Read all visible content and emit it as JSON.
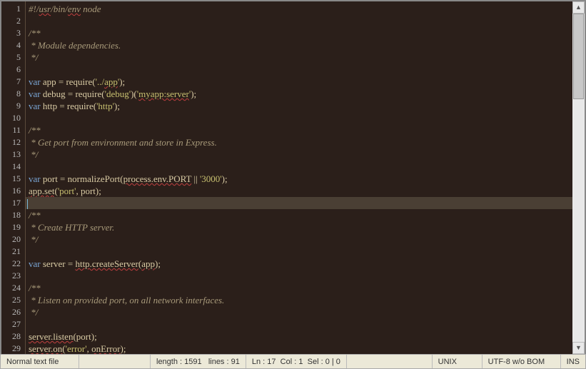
{
  "editor": {
    "current_line": 17,
    "lines": [
      {
        "n": 1,
        "tokens": [
          [
            "cm",
            "#!/"
          ],
          [
            "cm squiggle",
            "usr"
          ],
          [
            "cm",
            "/bin/"
          ],
          [
            "cm squiggle",
            "env"
          ],
          [
            "cm",
            " node"
          ]
        ]
      },
      {
        "n": 2,
        "tokens": []
      },
      {
        "n": 3,
        "tokens": [
          [
            "cmd",
            "/**"
          ]
        ]
      },
      {
        "n": 4,
        "tokens": [
          [
            "cmd",
            " * Module dependencies."
          ]
        ]
      },
      {
        "n": 5,
        "tokens": [
          [
            "cmd",
            " */"
          ]
        ]
      },
      {
        "n": 6,
        "tokens": []
      },
      {
        "n": 7,
        "tokens": [
          [
            "kw",
            "var"
          ],
          [
            "id",
            " app = require("
          ],
          [
            "str",
            "'../"
          ],
          [
            "str squiggle",
            "app"
          ],
          [
            "str",
            "'"
          ],
          [
            "id",
            ");"
          ]
        ]
      },
      {
        "n": 8,
        "tokens": [
          [
            "kw",
            "var"
          ],
          [
            "id",
            " debug = require("
          ],
          [
            "str",
            "'debug'"
          ],
          [
            "id",
            ")("
          ],
          [
            "str",
            "'"
          ],
          [
            "str squiggle",
            "myapp:server"
          ],
          [
            "str",
            "'"
          ],
          [
            "id",
            ");"
          ]
        ]
      },
      {
        "n": 9,
        "tokens": [
          [
            "kw",
            "var"
          ],
          [
            "id",
            " http = require("
          ],
          [
            "str",
            "'http'"
          ],
          [
            "id",
            ");"
          ]
        ]
      },
      {
        "n": 10,
        "tokens": []
      },
      {
        "n": 11,
        "tokens": [
          [
            "cmd",
            "/**"
          ]
        ]
      },
      {
        "n": 12,
        "tokens": [
          [
            "cmd",
            " * Get port from environment and store in Express."
          ]
        ]
      },
      {
        "n": 13,
        "tokens": [
          [
            "cmd",
            " */"
          ]
        ]
      },
      {
        "n": 14,
        "tokens": []
      },
      {
        "n": 15,
        "tokens": [
          [
            "kw",
            "var"
          ],
          [
            "id",
            " port = normalizePort("
          ],
          [
            "id squiggle",
            "process.env.PORT"
          ],
          [
            "id",
            " || "
          ],
          [
            "str",
            "'3000'"
          ],
          [
            "id",
            ");"
          ]
        ]
      },
      {
        "n": 16,
        "tokens": [
          [
            "id squiggle",
            "app.set"
          ],
          [
            "id",
            "("
          ],
          [
            "str",
            "'port'"
          ],
          [
            "id",
            ", port);"
          ]
        ]
      },
      {
        "n": 17,
        "tokens": []
      },
      {
        "n": 18,
        "tokens": [
          [
            "cmd",
            "/**"
          ]
        ]
      },
      {
        "n": 19,
        "tokens": [
          [
            "cmd",
            " * Create HTTP server."
          ]
        ]
      },
      {
        "n": 20,
        "tokens": [
          [
            "cmd",
            " */"
          ]
        ]
      },
      {
        "n": 21,
        "tokens": []
      },
      {
        "n": 22,
        "tokens": [
          [
            "kw",
            "var"
          ],
          [
            "id",
            " server = "
          ],
          [
            "id squiggle",
            "http.createServer"
          ],
          [
            "id",
            "("
          ],
          [
            "id squiggle",
            "app"
          ],
          [
            "id",
            ");"
          ]
        ]
      },
      {
        "n": 23,
        "tokens": []
      },
      {
        "n": 24,
        "tokens": [
          [
            "cmd",
            "/**"
          ]
        ]
      },
      {
        "n": 25,
        "tokens": [
          [
            "cmd",
            " * Listen on provided port, on all network interfaces."
          ]
        ]
      },
      {
        "n": 26,
        "tokens": [
          [
            "cmd",
            " */"
          ]
        ]
      },
      {
        "n": 27,
        "tokens": []
      },
      {
        "n": 28,
        "tokens": [
          [
            "id squiggle",
            "server.listen"
          ],
          [
            "id",
            "(port);"
          ]
        ]
      },
      {
        "n": 29,
        "tokens": [
          [
            "id squiggle",
            "server.on"
          ],
          [
            "id",
            "("
          ],
          [
            "str",
            "'error'"
          ],
          [
            "id",
            ", "
          ],
          [
            "id squiggle",
            "onError"
          ],
          [
            "id",
            ");"
          ]
        ]
      }
    ]
  },
  "status": {
    "filetype": "Normal text file",
    "length_label": "length :",
    "length_value": "1591",
    "lines_label": "lines :",
    "lines_value": "91",
    "ln_label": "Ln :",
    "ln_value": "17",
    "col_label": "Col :",
    "col_value": "1",
    "sel_label": "Sel :",
    "sel_value": "0 | 0",
    "eol": "UNIX",
    "encoding": "UTF-8 w/o BOM",
    "mode": "INS"
  },
  "scroll": {
    "up": "▲",
    "down": "▼"
  }
}
